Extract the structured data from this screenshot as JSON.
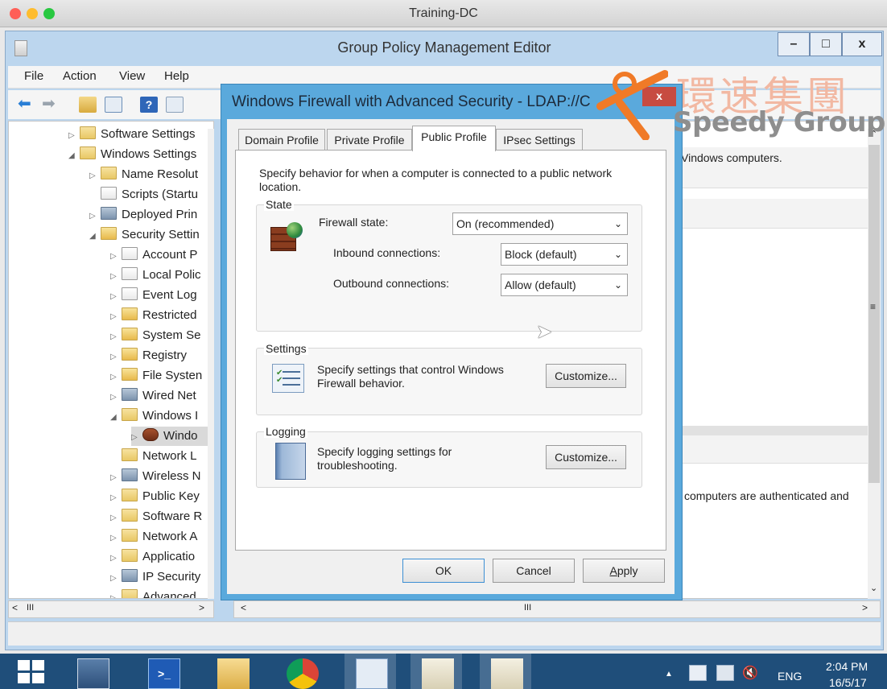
{
  "mac_window": {
    "title": "Training-DC"
  },
  "editor": {
    "title": "Group Policy Management Editor",
    "menu": [
      "File",
      "Action",
      "View",
      "Help"
    ],
    "window_buttons": {
      "minimize": "–",
      "restore": "□",
      "close": "x"
    }
  },
  "tree": {
    "items": [
      {
        "label": "Software Settings",
        "arrow": "▷",
        "icon": "folder"
      },
      {
        "label": "Windows Settings",
        "arrow": "◢",
        "icon": "folder"
      },
      {
        "label": "Name Resolut",
        "arrow": "▷",
        "icon": "folder"
      },
      {
        "label": "Scripts (Startu",
        "arrow": "",
        "icon": "script"
      },
      {
        "label": "Deployed Prin",
        "arrow": "▷",
        "icon": "printer"
      },
      {
        "label": "Security Settin",
        "arrow": "◢",
        "icon": "security"
      },
      {
        "label": "Account P",
        "arrow": "▷",
        "icon": "policy"
      },
      {
        "label": "Local Polic",
        "arrow": "▷",
        "icon": "policy"
      },
      {
        "label": "Event Log",
        "arrow": "▷",
        "icon": "policy"
      },
      {
        "label": "Restricted",
        "arrow": "▷",
        "icon": "lockfolder"
      },
      {
        "label": "System Se",
        "arrow": "▷",
        "icon": "lockfolder"
      },
      {
        "label": "Registry",
        "arrow": "▷",
        "icon": "lockfolder"
      },
      {
        "label": "File Systen",
        "arrow": "▷",
        "icon": "lockfolder"
      },
      {
        "label": "Wired Net",
        "arrow": "▷",
        "icon": "network"
      },
      {
        "label": "Windows I",
        "arrow": "◢",
        "icon": "folder"
      },
      {
        "label": "Windo",
        "arrow": "▷",
        "icon": "firewall"
      },
      {
        "label": "Network L",
        "arrow": "",
        "icon": "folder"
      },
      {
        "label": "Wireless N",
        "arrow": "▷",
        "icon": "network"
      },
      {
        "label": "Public Key",
        "arrow": "▷",
        "icon": "folder"
      },
      {
        "label": "Software R",
        "arrow": "▷",
        "icon": "folder"
      },
      {
        "label": "Network A",
        "arrow": "▷",
        "icon": "folder"
      },
      {
        "label": "Applicatio",
        "arrow": "▷",
        "icon": "folder"
      },
      {
        "label": "IP Security",
        "arrow": "▷",
        "icon": "ipsec"
      },
      {
        "label": "Advanced",
        "arrow": "▷",
        "icon": "folder"
      }
    ],
    "hscroll_label": "III"
  },
  "right_pane": {
    "text1": "Vindows computers.",
    "text2": "computers are authenticated and",
    "hscroll_label": "III",
    "scroll_mid": "≡"
  },
  "dialog": {
    "title": "Windows Firewall with Advanced Security - LDAP://C",
    "close": "x",
    "tabs": [
      "Domain Profile",
      "Private Profile",
      "Public Profile",
      "IPsec Settings"
    ],
    "active_tab": "Public Profile",
    "description": "Specify behavior for when a computer is connected to a public network location.",
    "state": {
      "label": "State",
      "firewall_state_label": "Firewall state:",
      "firewall_state_value": "On (recommended)",
      "inbound_label": "Inbound connections:",
      "inbound_value": "Block (default)",
      "outbound_label": "Outbound connections:",
      "outbound_value": "Allow (default)"
    },
    "settings": {
      "label": "Settings",
      "text": "Specify settings that control Windows Firewall behavior.",
      "button": "Customize..."
    },
    "logging": {
      "label": "Logging",
      "text": "Specify logging settings for troubleshooting.",
      "button": "Customize..."
    },
    "buttons": {
      "ok": "OK",
      "cancel": "Cancel",
      "apply": "Apply"
    },
    "caret": "⌄"
  },
  "watermark": {
    "cjk": "環速集團",
    "en": "Speedy Group"
  },
  "taskbar": {
    "clock_time": "2:04 PM",
    "clock_date": "16/5/17",
    "language": "ENG",
    "tray_arrow": "▲"
  }
}
